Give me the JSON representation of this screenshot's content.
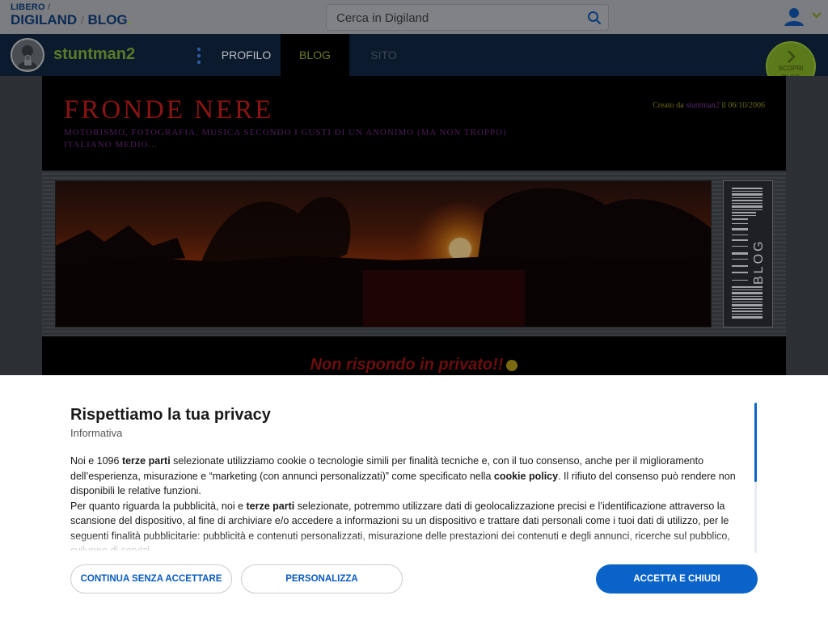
{
  "header": {
    "logo_top": "LIBERO",
    "logo_slash": "/",
    "logo_digiland": "DIGILAND",
    "logo_blog": "BLOG",
    "search_placeholder": "Cerca in Digiland"
  },
  "profile_nav": {
    "username": "stuntman2",
    "tabs": [
      {
        "label": "PROFILO",
        "active": false
      },
      {
        "label": "BLOG",
        "active": true
      },
      {
        "label": "SITO",
        "active": false
      }
    ],
    "discover_label_1": "SCOPRI",
    "discover_label_2": "BLOG"
  },
  "blog": {
    "title": "FRONDE NERE",
    "subtitle": "MOTORISMO, FOTOGRAFIA, MUSICA SECONDO I GUSTI DI UN ANONIMO (MA NON TROPPO) ITALIANO MEDIO...",
    "created_prefix": "Creato da",
    "created_author": "stuntman2",
    "created_suffix": "il 06/10/2006",
    "barcode_text": "BLOG",
    "notice": "Non rispondo in privato!!"
  },
  "privacy": {
    "title": "Rispettiamo la tua privacy",
    "subtitle": "Informativa",
    "p1_a": "Noi e 1096 ",
    "p1_b": "terze parti",
    "p1_c": " selezionate utilizziamo cookie o tecnologie simili per finalità tecniche e, con il tuo consenso, anche per il miglioramento dell’esperienza, misurazione e “marketing (con annunci personalizzati)” come specificato nella ",
    "p1_d": "cookie policy",
    "p1_e": ". Il rifiuto del consenso può rendere non disponibili le relative funzioni.",
    "p2_a": "Per quanto riguarda la pubblicità, noi e ",
    "p2_b": "terze parti",
    "p2_c": " selezionate, potremmo utilizzare dati di geolocalizzazione precisi e l’identificazione attraverso la scansione del dispositivo, al fine di archiviare e/o accedere a informazioni su un dispositivo e trattare dati personali come i tuoi dati di utilizzo, per le seguenti finalità pubblicitarie: pubblicità e contenuti personalizzati, misurazione delle prestazioni dei contenuti e degli annunci, ricerche sul pubblico, sviluppo di servizi.",
    "btn_continue": "CONTINUA SENZA ACCETTARE",
    "btn_customize": "PERSONALIZZA",
    "btn_accept": "ACCETTA E CHIUDI"
  },
  "colors": {
    "accent_green": "#6aa01e",
    "brand_blue": "#0a2a55",
    "button_blue": "#0a63c9",
    "blog_title_red": "#8a1414"
  }
}
